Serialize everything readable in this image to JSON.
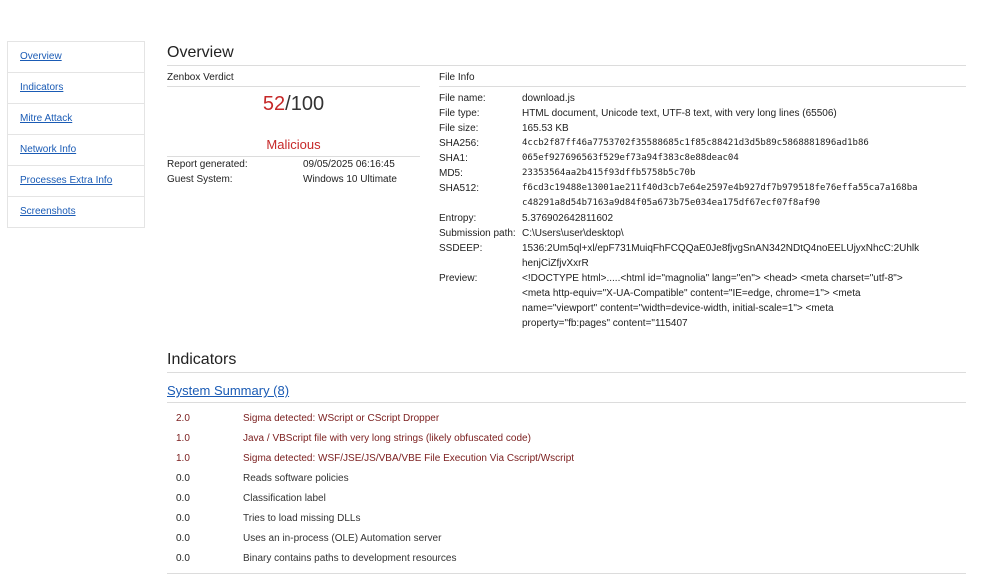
{
  "sidebar": {
    "items": [
      {
        "label": "Overview"
      },
      {
        "label": "Indicators"
      },
      {
        "label": "Mitre Attack"
      },
      {
        "label": "Network Info"
      },
      {
        "label": "Processes Extra Info"
      },
      {
        "label": "Screenshots"
      }
    ]
  },
  "overview": {
    "title": "Overview",
    "verdict": {
      "label": "Zenbox Verdict",
      "score": "52",
      "max": "/100",
      "result": "Malicious",
      "report_generated_label": "Report generated:",
      "report_generated_value": "09/05/2025 06:16:45",
      "guest_system_label": "Guest System:",
      "guest_system_value": "Windows 10 Ultimate"
    },
    "file_info": {
      "label": "File Info",
      "rows": [
        {
          "key": "File name:",
          "value": "download.js"
        },
        {
          "key": "File type:",
          "value": "HTML document, Unicode text, UTF-8 text, with very long lines (65506)"
        },
        {
          "key": "File size:",
          "value": "165.53 KB"
        },
        {
          "key": "SHA256:",
          "value": "4ccb2f87ff46a7753702f35588685c1f85c88421d3d5b89c5868881896ad1b86"
        },
        {
          "key": "SHA1:",
          "value": "065ef927696563f529ef73a94f383c8e88deac04"
        },
        {
          "key": "MD5:",
          "value": "23353564aa2b415f93dffb5758b5c70b"
        },
        {
          "key": "SHA512:",
          "value": "f6cd3c19488e13001ae211f40d3cb7e64e2597e4b927df7b979518fe76effa55ca7a168bac48291a8d54b7163a9d84f05a673b75e034ea175df67ecf07f8af90"
        },
        {
          "key": "Entropy:",
          "value": "5.376902642811602"
        },
        {
          "key": "Submission path:",
          "value": "C:\\Users\\user\\desktop\\"
        },
        {
          "key": "SSDEEP:",
          "value": "1536:2Um5ql+xl/epF731MuiqFhFCQQaE0Je8fjvgSnAN342NDtQ4noEELUjyxNhcC:2UhlkhenjCiZfjvXxrR"
        },
        {
          "key": "Preview:",
          "value": "<!DOCTYPE html>.....<html id=\"magnolia\" lang=\"en\"> <head> <meta charset=\"utf-8\"> <meta http-equiv=\"X-UA-Compatible\" content=\"IE=edge, chrome=1\"> <meta name=\"viewport\" content=\"width=device-width, initial-scale=1\"> <meta property=\"fb:pages\" content=\"115407"
        }
      ]
    }
  },
  "indicators": {
    "title": "Indicators",
    "summary_link": "System Summary (8)",
    "rows": [
      {
        "score": "2.0",
        "desc": "Sigma detected: WScript or CScript Dropper"
      },
      {
        "score": "1.0",
        "desc": "Java / VBScript file with very long strings (likely obfuscated code)"
      },
      {
        "score": "1.0",
        "desc": "Sigma detected: WSF/JSE/JS/VBA/VBE File Execution Via Cscript/Wscript"
      },
      {
        "score": "0.0",
        "desc": "Reads software policies"
      },
      {
        "score": "0.0",
        "desc": "Classification label"
      },
      {
        "score": "0.0",
        "desc": "Tries to load missing DLLs"
      },
      {
        "score": "0.0",
        "desc": "Uses an in-process (OLE) Automation server"
      },
      {
        "score": "0.0",
        "desc": "Binary contains paths to development resources"
      }
    ]
  }
}
